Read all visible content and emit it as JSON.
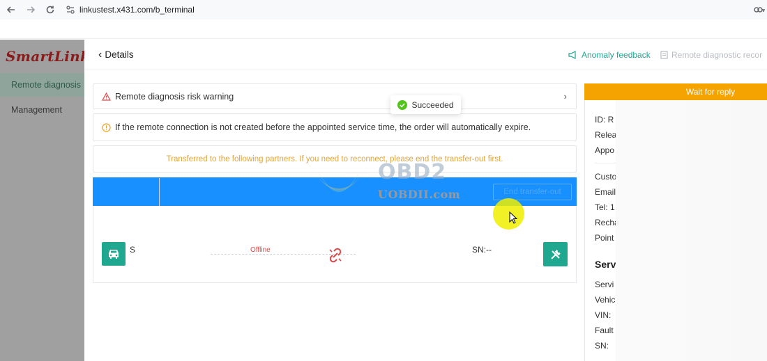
{
  "browser": {
    "url": "linkustest.x431.com/b_terminal",
    "icons": [
      "back-arrow-icon",
      "forward-arrow-icon",
      "reload-icon",
      "site-settings-icon",
      "password-key-icon"
    ]
  },
  "sidebar": {
    "logo": "SmartLink",
    "items": [
      {
        "label": "Remote diagnosis",
        "active": true
      },
      {
        "label": "Management",
        "active": false
      }
    ]
  },
  "header": {
    "back_label": "Details",
    "anomaly_feedback": "Anomaly feedback",
    "remote_records": "Remote diagnostic recor"
  },
  "notices": {
    "risk_warning": "Remote diagnosis risk warning",
    "expire_notice": "If the remote connection is not created before the appointed service time, the order will automatically expire.",
    "transfer_note": "Transferred to the following partners. If you need to reconnect, please end the transfer-out first."
  },
  "toast": {
    "text": "Succeeded"
  },
  "transfer": {
    "end_button": "End transfer-out"
  },
  "device": {
    "left_sn_prefix": "S",
    "status": "Offline",
    "right_sn": "SN:--"
  },
  "right_panel": {
    "status_bar": "Wait for reply",
    "fields": [
      "ID:  R",
      "Relea",
      "Appo",
      "Custo",
      "Email",
      "Tel:  1",
      "Recha",
      "Point"
    ],
    "section_title": "Serv",
    "service_fields": [
      "Servi",
      "Vehic",
      "VIN:",
      "Fault",
      "SN:"
    ]
  },
  "watermark": {
    "line1": "OBD2",
    "line2": "UOBDII.com"
  },
  "colors": {
    "accent": "#1fa58e",
    "blue_bar": "#1890ff",
    "warning": "#f4a300",
    "offline": "#e04848",
    "transfer_text": "#e0a43a"
  }
}
